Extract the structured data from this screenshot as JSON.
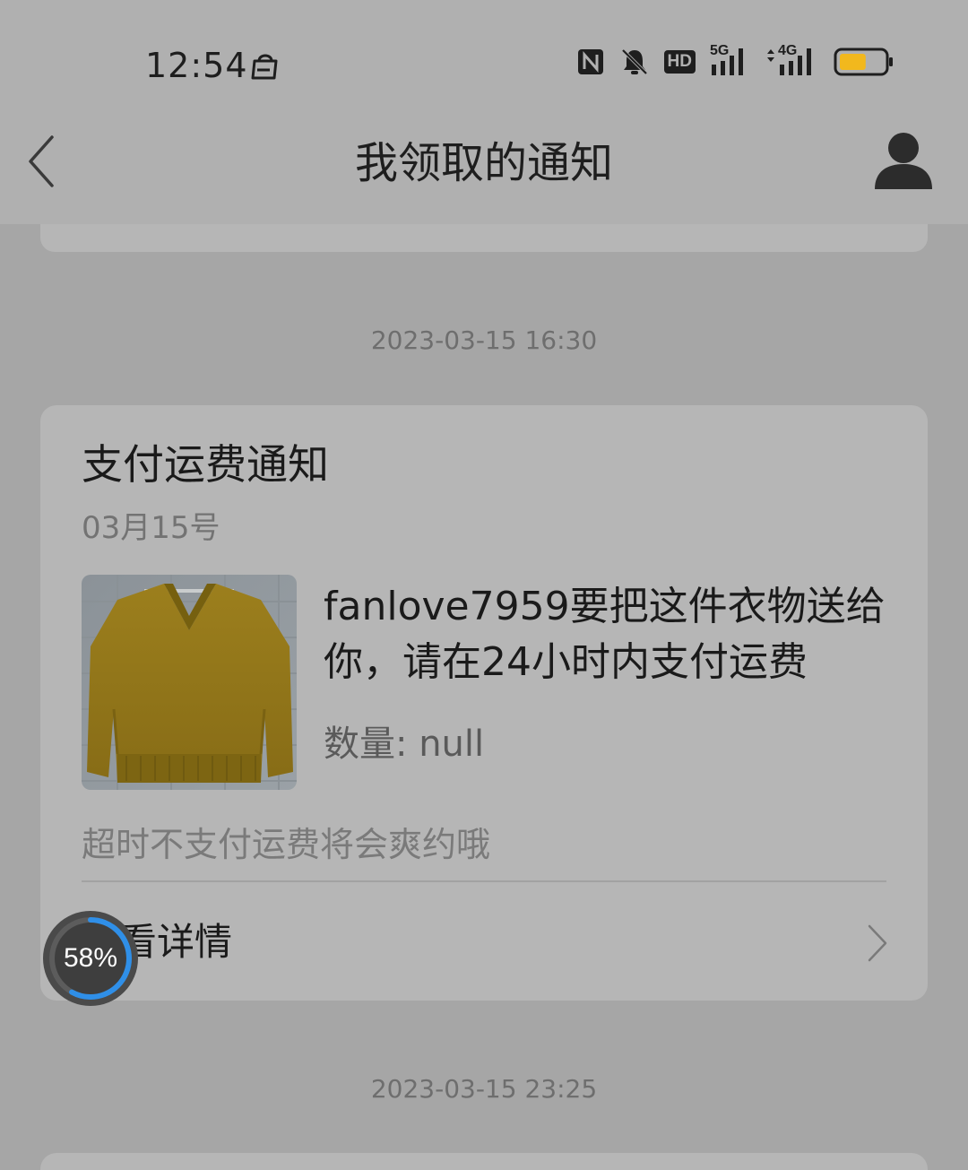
{
  "status_bar": {
    "time": "12:54",
    "network_1": "5G",
    "network_2": "4G",
    "hd_label": "HD",
    "battery_level": 0.6,
    "battery_color": "#f2b81d"
  },
  "header": {
    "title": "我领取的通知",
    "back_icon": "chevron-left-icon",
    "profile_icon": "user-icon"
  },
  "notifications": [
    {
      "timestamp": "2023-03-15 16:30",
      "title": "支付运费通知",
      "date": "03月15号",
      "message": "fanlove7959要把这件衣物送给你，请在24小时内支付运费",
      "quantity": "数量: null",
      "warning": "超时不支付运费将会爽约哦",
      "details_label": "查看详情"
    },
    {
      "timestamp": "2023-03-15 23:25"
    }
  ],
  "progress_badge": {
    "text": "58%",
    "value": 0.58,
    "accent": "#2f8fe8"
  }
}
